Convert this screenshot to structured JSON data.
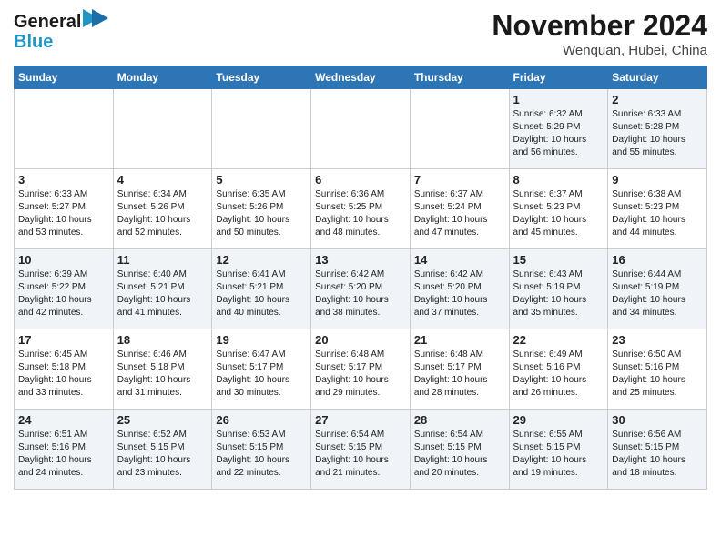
{
  "header": {
    "logo_line1": "General",
    "logo_line2": "Blue",
    "month_title": "November 2024",
    "location": "Wenquan, Hubei, China"
  },
  "days_of_week": [
    "Sunday",
    "Monday",
    "Tuesday",
    "Wednesday",
    "Thursday",
    "Friday",
    "Saturday"
  ],
  "weeks": [
    [
      {
        "day": "",
        "info": ""
      },
      {
        "day": "",
        "info": ""
      },
      {
        "day": "",
        "info": ""
      },
      {
        "day": "",
        "info": ""
      },
      {
        "day": "",
        "info": ""
      },
      {
        "day": "1",
        "info": "Sunrise: 6:32 AM\nSunset: 5:29 PM\nDaylight: 10 hours\nand 56 minutes."
      },
      {
        "day": "2",
        "info": "Sunrise: 6:33 AM\nSunset: 5:28 PM\nDaylight: 10 hours\nand 55 minutes."
      }
    ],
    [
      {
        "day": "3",
        "info": "Sunrise: 6:33 AM\nSunset: 5:27 PM\nDaylight: 10 hours\nand 53 minutes."
      },
      {
        "day": "4",
        "info": "Sunrise: 6:34 AM\nSunset: 5:26 PM\nDaylight: 10 hours\nand 52 minutes."
      },
      {
        "day": "5",
        "info": "Sunrise: 6:35 AM\nSunset: 5:26 PM\nDaylight: 10 hours\nand 50 minutes."
      },
      {
        "day": "6",
        "info": "Sunrise: 6:36 AM\nSunset: 5:25 PM\nDaylight: 10 hours\nand 48 minutes."
      },
      {
        "day": "7",
        "info": "Sunrise: 6:37 AM\nSunset: 5:24 PM\nDaylight: 10 hours\nand 47 minutes."
      },
      {
        "day": "8",
        "info": "Sunrise: 6:37 AM\nSunset: 5:23 PM\nDaylight: 10 hours\nand 45 minutes."
      },
      {
        "day": "9",
        "info": "Sunrise: 6:38 AM\nSunset: 5:23 PM\nDaylight: 10 hours\nand 44 minutes."
      }
    ],
    [
      {
        "day": "10",
        "info": "Sunrise: 6:39 AM\nSunset: 5:22 PM\nDaylight: 10 hours\nand 42 minutes."
      },
      {
        "day": "11",
        "info": "Sunrise: 6:40 AM\nSunset: 5:21 PM\nDaylight: 10 hours\nand 41 minutes."
      },
      {
        "day": "12",
        "info": "Sunrise: 6:41 AM\nSunset: 5:21 PM\nDaylight: 10 hours\nand 40 minutes."
      },
      {
        "day": "13",
        "info": "Sunrise: 6:42 AM\nSunset: 5:20 PM\nDaylight: 10 hours\nand 38 minutes."
      },
      {
        "day": "14",
        "info": "Sunrise: 6:42 AM\nSunset: 5:20 PM\nDaylight: 10 hours\nand 37 minutes."
      },
      {
        "day": "15",
        "info": "Sunrise: 6:43 AM\nSunset: 5:19 PM\nDaylight: 10 hours\nand 35 minutes."
      },
      {
        "day": "16",
        "info": "Sunrise: 6:44 AM\nSunset: 5:19 PM\nDaylight: 10 hours\nand 34 minutes."
      }
    ],
    [
      {
        "day": "17",
        "info": "Sunrise: 6:45 AM\nSunset: 5:18 PM\nDaylight: 10 hours\nand 33 minutes."
      },
      {
        "day": "18",
        "info": "Sunrise: 6:46 AM\nSunset: 5:18 PM\nDaylight: 10 hours\nand 31 minutes."
      },
      {
        "day": "19",
        "info": "Sunrise: 6:47 AM\nSunset: 5:17 PM\nDaylight: 10 hours\nand 30 minutes."
      },
      {
        "day": "20",
        "info": "Sunrise: 6:48 AM\nSunset: 5:17 PM\nDaylight: 10 hours\nand 29 minutes."
      },
      {
        "day": "21",
        "info": "Sunrise: 6:48 AM\nSunset: 5:17 PM\nDaylight: 10 hours\nand 28 minutes."
      },
      {
        "day": "22",
        "info": "Sunrise: 6:49 AM\nSunset: 5:16 PM\nDaylight: 10 hours\nand 26 minutes."
      },
      {
        "day": "23",
        "info": "Sunrise: 6:50 AM\nSunset: 5:16 PM\nDaylight: 10 hours\nand 25 minutes."
      }
    ],
    [
      {
        "day": "24",
        "info": "Sunrise: 6:51 AM\nSunset: 5:16 PM\nDaylight: 10 hours\nand 24 minutes."
      },
      {
        "day": "25",
        "info": "Sunrise: 6:52 AM\nSunset: 5:15 PM\nDaylight: 10 hours\nand 23 minutes."
      },
      {
        "day": "26",
        "info": "Sunrise: 6:53 AM\nSunset: 5:15 PM\nDaylight: 10 hours\nand 22 minutes."
      },
      {
        "day": "27",
        "info": "Sunrise: 6:54 AM\nSunset: 5:15 PM\nDaylight: 10 hours\nand 21 minutes."
      },
      {
        "day": "28",
        "info": "Sunrise: 6:54 AM\nSunset: 5:15 PM\nDaylight: 10 hours\nand 20 minutes."
      },
      {
        "day": "29",
        "info": "Sunrise: 6:55 AM\nSunset: 5:15 PM\nDaylight: 10 hours\nand 19 minutes."
      },
      {
        "day": "30",
        "info": "Sunrise: 6:56 AM\nSunset: 5:15 PM\nDaylight: 10 hours\nand 18 minutes."
      }
    ]
  ]
}
